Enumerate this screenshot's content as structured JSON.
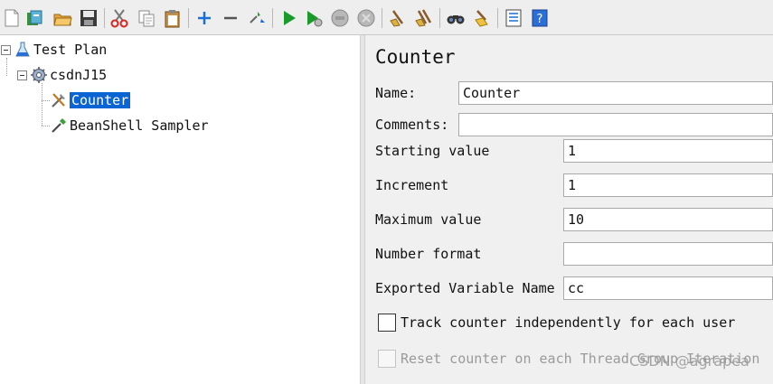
{
  "toolbar": {
    "buttons": [
      "new-icon",
      "templates-icon",
      "open-icon",
      "save-icon",
      "cut-icon",
      "copy-icon",
      "paste-icon",
      "expand-icon",
      "collapse-icon",
      "toggle-icon",
      "start-icon",
      "start-no-pause-icon",
      "stop-icon",
      "shutdown-icon",
      "clear-icon",
      "clear-all-icon",
      "search-icon",
      "reset-search-icon",
      "function-helper-icon",
      "help-icon"
    ]
  },
  "tree": {
    "root": "Test Plan",
    "thread_group": "csdnJ15",
    "items": [
      "Counter",
      "BeanShell Sampler"
    ]
  },
  "form": {
    "title": "Counter",
    "name_label": "Name:",
    "name_value": "Counter",
    "comments_label": "Comments:",
    "comments_value": "",
    "start_label": "Starting value",
    "start_value": "1",
    "increment_label": "Increment",
    "increment_value": "1",
    "max_label": "Maximum value",
    "max_value": "10",
    "format_label": "Number format",
    "format_value": "",
    "var_label": "Exported Variable Name",
    "var_value": "cc",
    "track_label": "Track counter independently for each user",
    "track_checked": false,
    "reset_label": "Reset counter on each Thread Group Iteration",
    "reset_enabled": false
  },
  "watermark": "CSDN @agrapea",
  "colors": {
    "selection": "#0a64d4",
    "start_green": "#1a9a2a"
  }
}
